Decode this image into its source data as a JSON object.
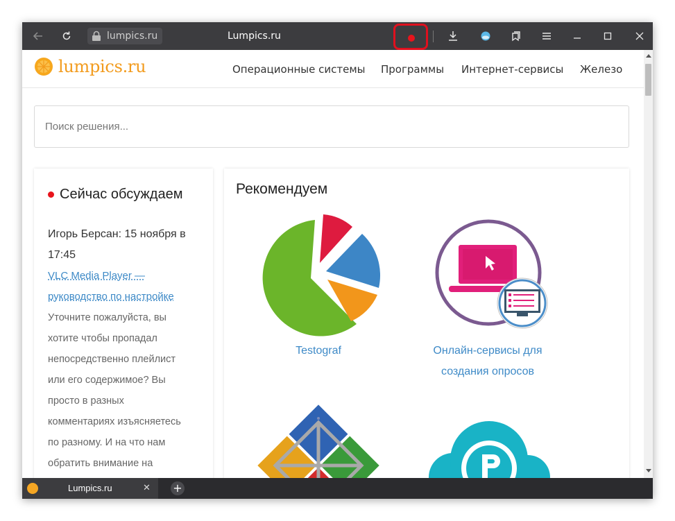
{
  "browser": {
    "address": "lumpics.ru",
    "page_title": "Lumpics.ru"
  },
  "site": {
    "logo_text": "lumpics.ru",
    "nav": [
      "Операционные системы",
      "Программы",
      "Интернет-сервисы",
      "Железо"
    ]
  },
  "search": {
    "placeholder": "Поиск решения..."
  },
  "discussion": {
    "title": "Сейчас обсуждаем",
    "author_line_1": "Игорь Берсан: 15 ноября в",
    "author_line_2": "17:45",
    "link_line_1": "VLC Media Player —",
    "link_line_2": "руководство по настройке",
    "comment_lines": [
      "Уточните пожалуйста, вы",
      "хотите чтобы пропадал",
      "непосредственно плейлист",
      "или его содержимое? Вы",
      "просто в разных",
      "комментариях изъясняетесь",
      "по разному. И на что нам",
      "обратить внимание на"
    ]
  },
  "recommend": {
    "title": "Рекомендуем",
    "items": [
      {
        "label_line_1": "Testograf",
        "label_line_2": ""
      },
      {
        "label_line_1": "Онлайн-сервисы для",
        "label_line_2": "создания опросов"
      }
    ]
  },
  "tabs": [
    {
      "label": "Lumpics.ru"
    }
  ],
  "colors": {
    "accent_orange": "#f29b1d",
    "link_blue": "#3e8ac7",
    "record_red": "#e8141c",
    "browser_dark": "#3c3c3f"
  }
}
